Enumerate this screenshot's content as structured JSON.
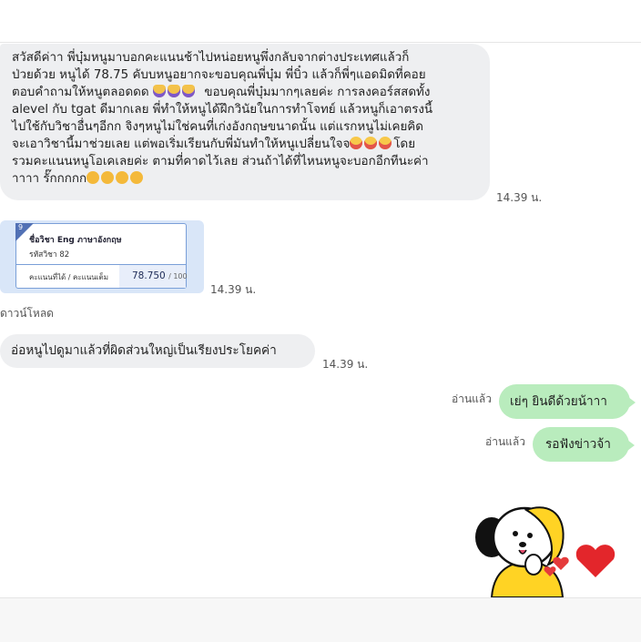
{
  "messages": [
    {
      "type": "received_text",
      "lines": [
        "สวัสดีค่าา พี่บุ๋มหนูมาบอกคะแนนช้าไปหน่อยหนูพึ่งกลับจากต่างประเทศแล้วก็",
        "ป่วยด้วย หนูได้ 78.75 คับบหนูอยากจะขอบคุณพี่บุ๋ม พี่บิ๋ว แล้วก็พี่ๆแอดมิดที่คอย",
        "ตอบคำถามให้หนูตลอดดด",
        "ขอบคุณพี่บุ๋มมากๆเลยค่ะ การลงคอร์สสดทั้ง",
        "alevel กับ tgat ดีมากเลย พี่ทำให้หนูได้ฝึกวินัยในการทำโจทย์ แล้วหนูก็เอาตรงนี้",
        "ไปใช้กับวิชาอื่นๆอีกก จิงๆหนูไม่ใช่คนที่เก่งอังกฤษขนาดนั้น แต่แรกหนูไม่เคยคิด",
        "จะเอาวิชานี้มาช่วยเลย แต่พอเริ่มเรียนกับพี่มันทำให้หนูเปลี่ยนใจจ",
        "โดย",
        "รวมคะแนนหนูโอเคเลยค่ะ ตามที่คาดไว้เลย ส่วนถ้าได้ที่ไหนหนูจะบอกอีกทีนะค่า",
        "าาาา รั๊กกกกก"
      ],
      "time": "14.39 น."
    },
    {
      "type": "received_image",
      "card": {
        "badge": "9",
        "subject": "ชื่อวิชา Eng ภาษาอังกฤษ",
        "code": "รหัสวิชา 82",
        "score_label": "คะแนนที่ได้ / คะแนนเต็ม",
        "score": "78.750",
        "score_max": "/ 100"
      },
      "time": "14.39 น.",
      "download_label": "ดาวน์โหลด"
    },
    {
      "type": "received_text",
      "text": "อ่อหนูไปดูมาแล้วที่ผิดส่วนใหญ่เป็นเรียงประโยคค่า",
      "time": "14.39 น."
    },
    {
      "type": "sent_text",
      "text": "เย่ๆ ยินดีด้วยน้าาา",
      "status": "อ่านแล้ว"
    },
    {
      "type": "sent_text",
      "text": "รอฟังข่าวจ้า",
      "status": "อ่านแล้ว"
    },
    {
      "type": "sent_sticker",
      "sticker": "yellow-dog-character-with-hearts"
    }
  ],
  "colors": {
    "incoming_bubble": "#eeeff1",
    "outgoing_bubble": "#b9ecbd",
    "card_accent": "#5271b5"
  }
}
